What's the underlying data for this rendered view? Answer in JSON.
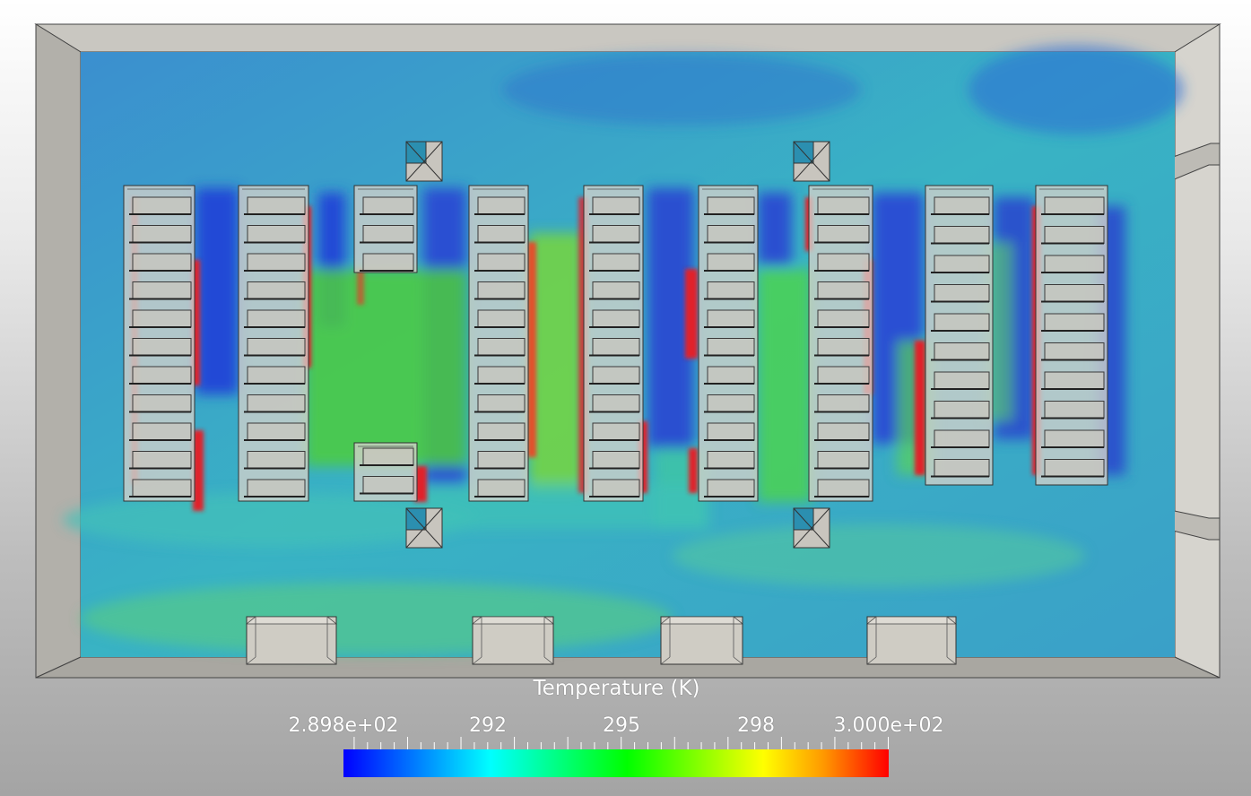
{
  "colorbar": {
    "title": "Temperature (K)",
    "min_label": "2.898e+02",
    "max_label": "3.000e+02",
    "tick_labels": [
      "292",
      "295",
      "298"
    ],
    "range": [
      289.8,
      300.0
    ],
    "colormap": [
      "#0000ff",
      "#00ffff",
      "#00ff00",
      "#ffff00",
      "#ff0000"
    ]
  },
  "colors": {
    "room_background": "#3aa6c4",
    "cold": "#1f4fd0",
    "warm": "#4cd23c",
    "hot": "#e0202a",
    "wall": "#c4c2bc",
    "equipment": "#cfccc4"
  }
}
